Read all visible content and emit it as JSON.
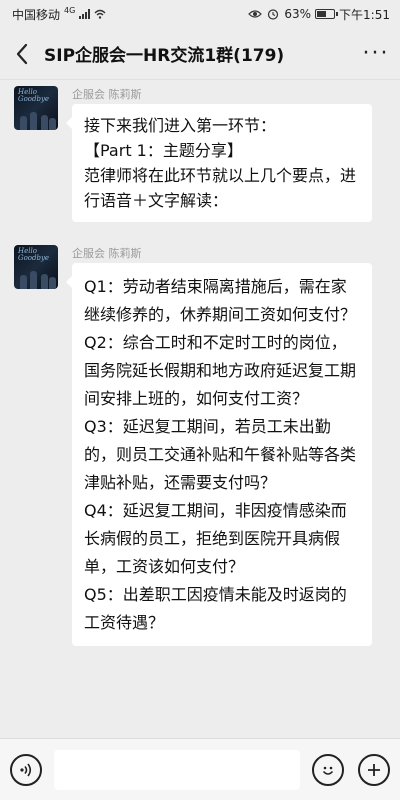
{
  "status_bar": {
    "carrier": "中国移动",
    "network": "4G",
    "battery": "63%",
    "battery_level": 0.63,
    "time": "下午1:51"
  },
  "header": {
    "title": "SIP企服会一HR交流1群(179)",
    "more_label": "···"
  },
  "messages": [
    {
      "sender": "企服会 陈莉斯",
      "avatar_caption": "Hello Goodbye",
      "text": "接下来我们进入第一环节：\n【Part 1：主题分享】\n范律师将在此环节就以上几个要点，进行语音＋文字解读："
    },
    {
      "sender": "企服会 陈莉斯",
      "avatar_caption": "Hello Goodbye",
      "text": "Q1：劳动者结束隔离措施后，需在家继续修养的，休养期间工资如何支付？\nQ2：综合工时和不定时工时的岗位，国务院延长假期和地方政府延迟复工期间安排上班的，如何支付工资？\nQ3：延迟复工期间，若员工未出勤的，则员工交通补贴和午餐补贴等各类津贴补贴，还需要支付吗？\nQ4：延迟复工期间，非因疫情感染而长病假的员工，拒绝到医院开具病假单，工资该如何支付？\nQ5：出差职工因疫情未能及时返岗的工资待遇？"
    }
  ],
  "input_bar": {
    "placeholder": ""
  },
  "colors": {
    "background": "#ededed",
    "bubble": "#ffffff",
    "sender_name": "#9a9a9a"
  }
}
